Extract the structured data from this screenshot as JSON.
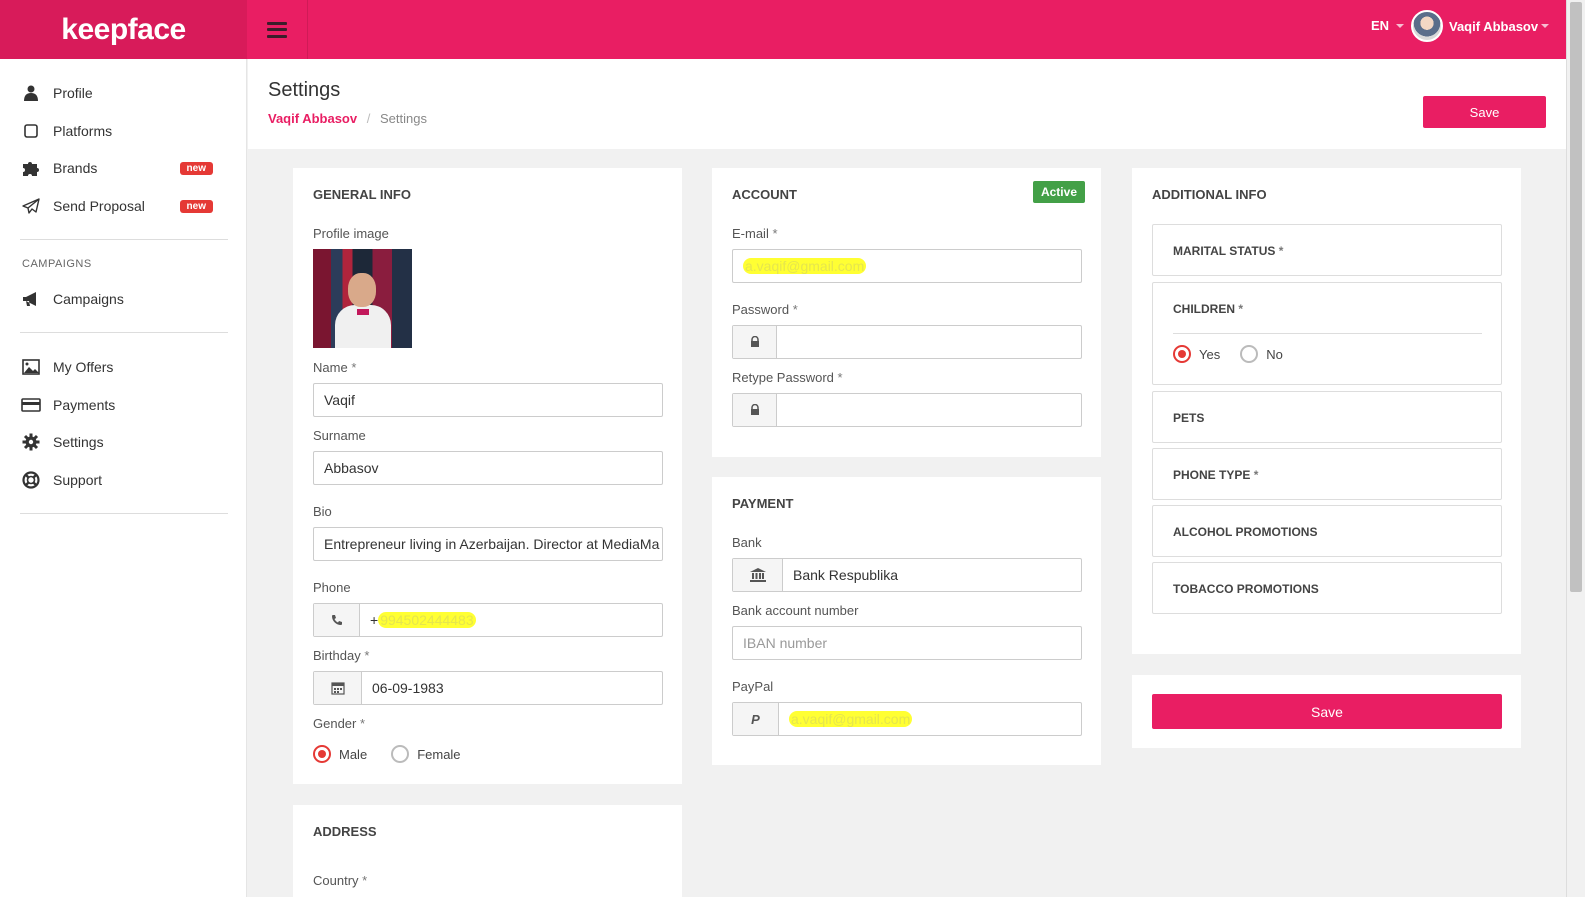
{
  "brand": "keepface",
  "topbar": {
    "language": "EN",
    "user_name": "Vaqif Abbasov"
  },
  "sidebar": {
    "items": [
      {
        "label": "Profile",
        "icon": "user-icon"
      },
      {
        "label": "Platforms",
        "icon": "square-icon"
      },
      {
        "label": "Brands",
        "icon": "puzzle-icon",
        "badge": "new"
      },
      {
        "label": "Send Proposal",
        "icon": "paper-plane-icon",
        "badge": "new"
      }
    ],
    "campaigns_heading": "CAMPAIGNS",
    "campaigns_item": {
      "label": "Campaigns",
      "icon": "megaphone-icon"
    },
    "account_items": [
      {
        "label": "My Offers",
        "icon": "image-icon"
      },
      {
        "label": "Payments",
        "icon": "credit-card-icon"
      },
      {
        "label": "Settings",
        "icon": "gear-icon"
      },
      {
        "label": "Support",
        "icon": "life-ring-icon"
      }
    ]
  },
  "page": {
    "title": "Settings",
    "breadcrumb": {
      "link": "Vaqif Abbasov",
      "separator": "/",
      "current": "Settings"
    },
    "save_label": "Save"
  },
  "general": {
    "title": "GENERAL INFO",
    "profile_image_label": "Profile image",
    "name_label": "Name",
    "name_value": "Vaqif",
    "surname_label": "Surname",
    "surname_value": "Abbasov",
    "bio_label": "Bio",
    "bio_value": "Entrepreneur living in Azerbaijan. Director at MediaMa",
    "phone_label": "Phone",
    "phone_prefix": "+",
    "phone_value": "994502444483",
    "birthday_label": "Birthday",
    "birthday_value": "06-09-1983",
    "gender_label": "Gender",
    "gender_options": [
      "Male",
      "Female"
    ],
    "gender_selected": "Male",
    "required_mark": "*"
  },
  "address": {
    "title": "ADDRESS",
    "country_label": "Country"
  },
  "account": {
    "title": "ACCOUNT",
    "status": "Active",
    "email_label": "E-mail",
    "email_value": "a.vaqif@gmail.com",
    "password_label": "Password",
    "retype_label": "Retype Password"
  },
  "payment": {
    "title": "PAYMENT",
    "bank_label": "Bank",
    "bank_value": "Bank Respublika",
    "account_label": "Bank account number",
    "account_placeholder": "IBAN number",
    "paypal_label": "PayPal",
    "paypal_value": "a.vaqif@gmail.com"
  },
  "additional": {
    "title": "ADDITIONAL INFO",
    "marital": "MARITAL STATUS",
    "children": "CHILDREN",
    "children_options": [
      "Yes",
      "No"
    ],
    "children_selected": "Yes",
    "pets": "PETS",
    "phone_type": "PHONE TYPE",
    "alcohol": "ALCOHOL PROMOTIONS",
    "tobacco": "TOBACCO PROMOTIONS",
    "save_label": "Save"
  },
  "colors": {
    "brand": "#e91e63",
    "active": "#43a047",
    "radio": "#e53935"
  }
}
